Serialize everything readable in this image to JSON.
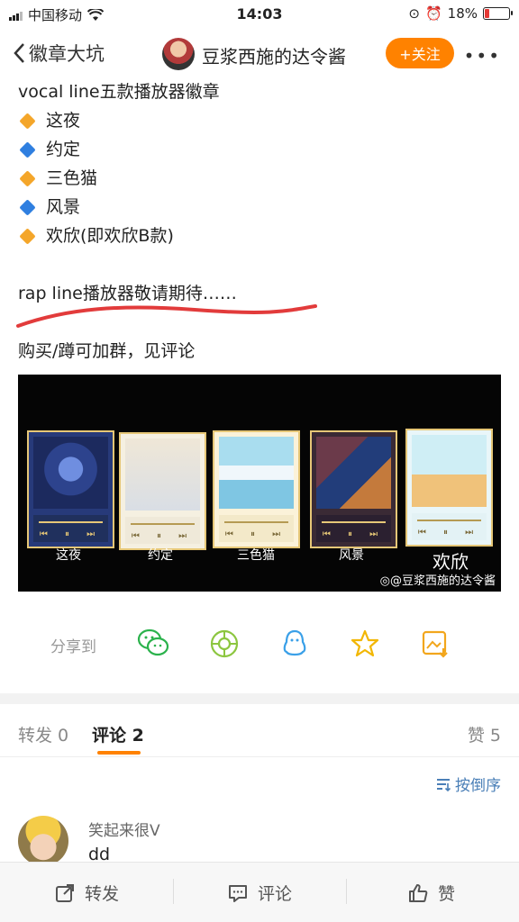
{
  "status_bar": {
    "carrier": "中国移动",
    "time": "14:03",
    "battery": "18%",
    "battery_level": 0.18
  },
  "nav": {
    "back_label": "徽章大坑",
    "author": "豆浆西施的达令酱",
    "follow_label": "+关注"
  },
  "post": {
    "heading": "vocal line五款播放器徽章",
    "items": [
      {
        "text": "这夜",
        "color": "#f4a62a"
      },
      {
        "text": "约定",
        "color": "#2f7fe0"
      },
      {
        "text": "三色猫",
        "color": "#f4a62a"
      },
      {
        "text": "风景",
        "color": "#2f7fe0"
      },
      {
        "text": "欢欣(即欢欣B款)",
        "color": "#f4a62a"
      }
    ],
    "note": "rap line播放器敬请期待……",
    "buy": "购买/蹲可加群，见评论"
  },
  "banner": {
    "captions": [
      "这夜",
      "约定",
      "三色猫",
      "风景",
      "欢欣"
    ],
    "watermark": "@豆浆西施的达令酱"
  },
  "share": {
    "label": "分享到"
  },
  "tabs": {
    "repost": "转发 0",
    "comments": "评论 2",
    "likes": "赞 5"
  },
  "sort_label": "按倒序",
  "comment": {
    "user": "笑起来很V",
    "text": "dd"
  },
  "bottom": {
    "repost": "转发",
    "comment": "评论",
    "like": "赞"
  }
}
